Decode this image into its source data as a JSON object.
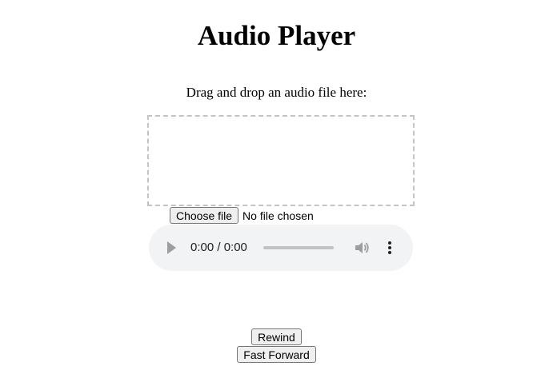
{
  "page": {
    "title": "Audio Player",
    "drop_instructions": "Drag and drop an audio file here:"
  },
  "file_input": {
    "button_label": "Choose file",
    "status_text": "No file chosen"
  },
  "audio_player": {
    "time_display": "0:00 / 0:00",
    "progress": 0,
    "icons": {
      "play": "play-icon",
      "volume": "volume-icon",
      "more": "more-options-icon"
    },
    "colors": {
      "background": "#f1f3f4",
      "icon": "#9e9e9e"
    }
  },
  "controls": {
    "rewind_label": "Rewind",
    "fast_forward_label": "Fast Forward"
  }
}
